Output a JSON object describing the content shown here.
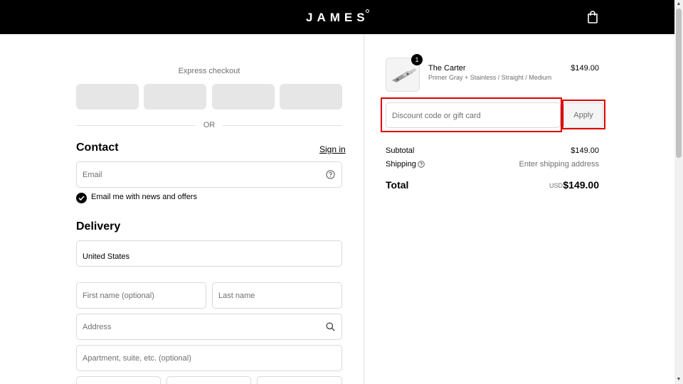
{
  "header": {
    "logo_text": "JAMES",
    "cart_icon": "shopping-bag-icon"
  },
  "checkout": {
    "express_label": "Express checkout",
    "or_label": "OR",
    "contact": {
      "heading": "Contact",
      "signin_label": "Sign in",
      "email_placeholder": "Email",
      "newsletter_label": "Email me with news and offers",
      "newsletter_checked": true
    },
    "delivery": {
      "heading": "Delivery",
      "country_value": "United States",
      "first_name_placeholder": "First name (optional)",
      "last_name_placeholder": "Last name",
      "address_placeholder": "Address",
      "apartment_placeholder": "Apartment, suite, etc. (optional)"
    }
  },
  "summary": {
    "product": {
      "quantity": "1",
      "name": "The Carter",
      "variant": "Primer Gray + Stainless / Straight / Medium",
      "price": "$149.00"
    },
    "discount_placeholder": "Discount code or gift card",
    "apply_label": "Apply",
    "subtotal_label": "Subtotal",
    "subtotal_value": "$149.00",
    "shipping_label": "Shipping",
    "shipping_value": "Enter shipping address",
    "total_label": "Total",
    "total_currency": "USD",
    "total_value": "$149.00"
  },
  "colors": {
    "header_bg": "#000000",
    "highlight": "#e00000",
    "placeholder_text": "#707070"
  }
}
